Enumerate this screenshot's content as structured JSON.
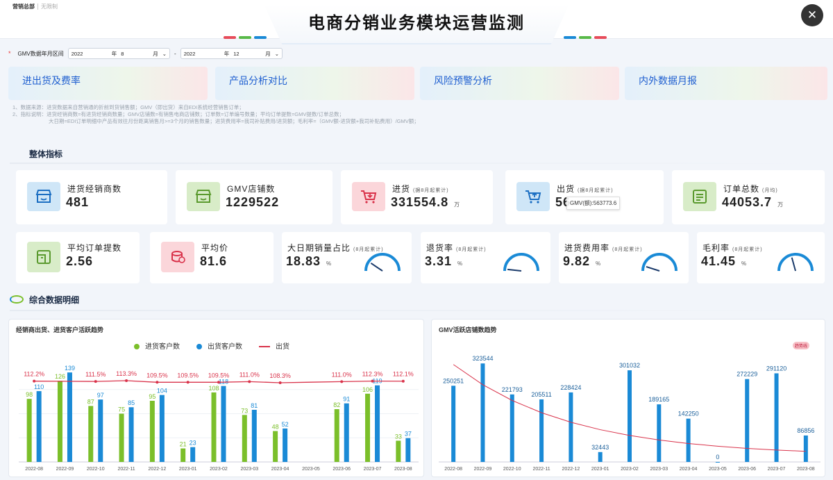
{
  "header": {
    "breadcrumb_main": "营销总部",
    "breadcrumb_sub": "无限制",
    "title": "电商分销业务模块运营监测"
  },
  "filter": {
    "label": "GMV数据年月区间",
    "start_year": "2022",
    "start_year_unit": "年",
    "start_month": "8",
    "start_month_unit": "月",
    "sep": "-",
    "end_year": "2022",
    "end_year_unit": "年",
    "end_month": "12",
    "end_month_unit": "月"
  },
  "tabs": [
    "进出货及费率",
    "产品分析对比",
    "风险预警分析",
    "内外数据月报"
  ],
  "notes": [
    "1、数据来源：进货数据来自营销通的折前到货销售额；GMV（即出货）来自EDI系统经营销售订单；",
    "2、指标说明：进货经销商数=有进货经销商数量；GMV店铺数=有销售电商店铺数；订单数=订单编号数量；平均订单提数=GMV提数/订单总数；",
    "大日期=EDI订单明细中产品有效往月份距离销售月>=3个月的销售数量；进货费用率=我司补贴费用/进货额；毛利率=（GMV额-进货额+我司补贴费用）/GMV额；"
  ],
  "section_overall": "整体指标",
  "section_detail": "综合数据明细",
  "kpi_row1": [
    {
      "label": "进货经销商数",
      "sub": "",
      "value": "481",
      "unit": "",
      "icon": "store-icon",
      "color": "blue"
    },
    {
      "label": "GMV店铺数",
      "sub": "",
      "value": "1229522",
      "unit": "",
      "icon": "shop-icon",
      "color": "green"
    },
    {
      "label": "进货",
      "sub": "(据8月起累计)",
      "value": "331554.8",
      "unit": "万",
      "icon": "cart-in-icon",
      "color": "red"
    },
    {
      "label": "出货",
      "sub": "(据8月起累计)",
      "value": "56",
      "unit": "",
      "icon": "cart-out-icon",
      "color": "blue"
    },
    {
      "label": "订单总数",
      "sub": "(月均)",
      "value": "44053.7",
      "unit": "万",
      "icon": "order-icon",
      "color": "green"
    }
  ],
  "tooltip": "GMV(额):563773.6",
  "kpi_row2": [
    {
      "label": "平均订单提数",
      "value": "2.56",
      "icon": "doc-icon",
      "color": "green"
    },
    {
      "label": "平均价",
      "value": "81.6",
      "icon": "coin-icon",
      "color": "red"
    }
  ],
  "gauges": [
    {
      "label": "大日期销量占比",
      "sub": "(8月起累计)",
      "value": "18.83",
      "unit": "%",
      "level": 0.1883
    },
    {
      "label": "退货率",
      "sub": "(8月起累计)",
      "value": "3.31",
      "unit": "%",
      "level": 0.0331
    },
    {
      "label": "进货费用率",
      "sub": "(8月起累计)",
      "value": "9.82",
      "unit": "%",
      "level": 0.0982
    },
    {
      "label": "毛利率",
      "sub": "(8月起累计)",
      "value": "41.45",
      "unit": "%",
      "level": 0.4145
    }
  ],
  "colors": {
    "green": "#7bbf2a",
    "blue": "#1a8ad6",
    "red": "#d9324a",
    "accent": "#1f5fd0"
  },
  "chart_data": [
    {
      "type": "bar",
      "title": "经销商出货、进货客户活跃趋势",
      "categories": [
        "2022-08",
        "2022-09",
        "2022-10",
        "2022-11",
        "2022-12",
        "2023-01",
        "2023-02",
        "2023-03",
        "2023-04",
        "2023-05",
        "2023-06",
        "2023-07",
        "2023-08"
      ],
      "series": [
        {
          "name": "进货客户数",
          "values": [
            98,
            126,
            87,
            75,
            95,
            21,
            108,
            73,
            48,
            null,
            82,
            106,
            33
          ],
          "color": "#7bbf2a"
        },
        {
          "name": "出货客户数",
          "values": [
            110,
            139,
            97,
            85,
            104,
            23,
            118,
            81,
            52,
            null,
            91,
            119,
            37
          ],
          "color": "#1a8ad6"
        },
        {
          "name": "出货",
          "type": "line",
          "values": [
            112.2,
            null,
            111.5,
            113.3,
            109.5,
            109.5,
            109.5,
            111.0,
            108.3,
            null,
            111.0,
            112.3,
            112.1
          ],
          "color": "#d9324a",
          "labels": [
            "112.2%",
            "",
            "111.5%",
            "113.3%",
            "109.5%",
            "109.5%",
            "109.5%",
            "111.0%",
            "108.3%",
            "",
            "111.0%",
            "112.3%",
            "112.1%"
          ]
        }
      ],
      "legend": "top-center"
    },
    {
      "type": "bar",
      "title": "GMV活跃店铺数趋势",
      "badge": "趋势线",
      "categories": [
        "2022-08",
        "2022-09",
        "2022-10",
        "2022-11",
        "2022-12",
        "2023-01",
        "2023-02",
        "2023-03",
        "2023-04",
        "2023-05",
        "2023-06",
        "2023-07",
        "2023-08"
      ],
      "series": [
        {
          "name": "GMV活跃店铺数",
          "values": [
            250251,
            323544,
            221793,
            205511,
            228424,
            32443,
            301032,
            189165,
            142250,
            0,
            272229,
            291120,
            86856
          ],
          "color": "#1a8ad6"
        }
      ],
      "trendline": true
    }
  ]
}
